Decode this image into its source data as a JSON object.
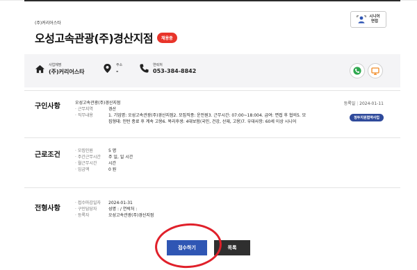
{
  "header": {
    "company_small": "(주)커리어스타",
    "title": "오성고속관광(주)경산지점",
    "badge": "채용중",
    "senior_label": "시니어\n면접",
    "info": {
      "biz_label": "사업체명",
      "biz_value": "(주)커리어스타",
      "addr_label": "주소",
      "addr_value": "-",
      "phone_label": "연락처",
      "phone_value": "053-384-8842"
    }
  },
  "recruit": {
    "title": "구인사항",
    "company": "오성고속관광(주)경산지점",
    "rows": [
      {
        "label": "· 근무지역",
        "value": "경산"
      },
      {
        "label": "· 직무내용",
        "value": "1. 기업명: 오성고속관광(주)경산지점2. 모집직종: 운전원3. 근무시간: 07:00~18:004. 급여: 면접 후 협의5. 모"
      },
      {
        "label": "",
        "value": "집형태: 인턴 종료 후 계속 고용6. 복리후생: 4대보험(국민, 건강, 산재, 고용)7. 우대사항: 60세 이상 시니어"
      }
    ],
    "reg_date_label": "등록일",
    "reg_date": "2024-01-11",
    "tag": "청두지원협약사업"
  },
  "work": {
    "title": "근로조건",
    "rows": [
      {
        "label": "· 모집인원",
        "value": "5 명"
      },
      {
        "label": "· 주간근무시간",
        "value": "주 일, 일 시간"
      },
      {
        "label": "· 월근무시간",
        "value": "시간"
      },
      {
        "label": "· 임금액",
        "value": "0 원"
      }
    ]
  },
  "selection": {
    "title": "전형사항",
    "rows": [
      {
        "label": "· 접수마감일자",
        "value": "2024-01-31"
      },
      {
        "label": "· 구인담당자",
        "value": "성명 : / 연락처 :"
      },
      {
        "label": "· 등록자",
        "value": "오성고속관광(주)경산지점"
      }
    ]
  },
  "buttons": {
    "apply": "접수하기",
    "list": "목록"
  },
  "colors": {
    "badge_red": "#e8342a",
    "apply_blue": "#2f56b4",
    "tag_navy": "#2f4a9b",
    "annotation_red": "#e0202a"
  }
}
